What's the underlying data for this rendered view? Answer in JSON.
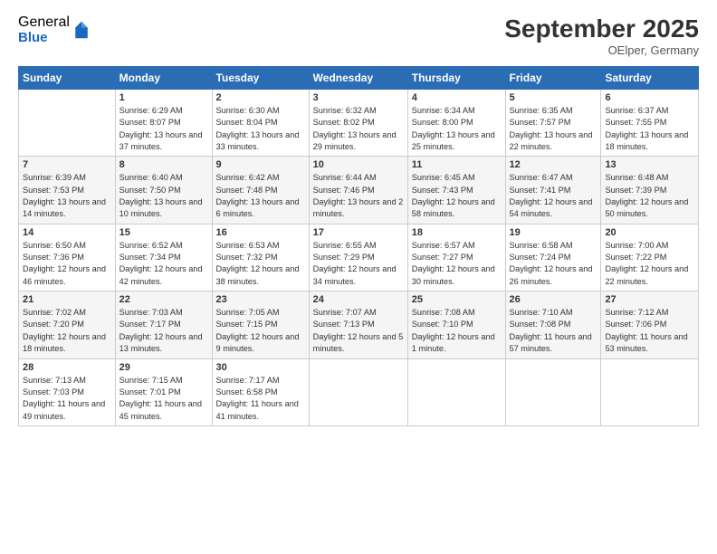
{
  "logo": {
    "general": "General",
    "blue": "Blue"
  },
  "title": "September 2025",
  "location": "OElper, Germany",
  "headers": [
    "Sunday",
    "Monday",
    "Tuesday",
    "Wednesday",
    "Thursday",
    "Friday",
    "Saturday"
  ],
  "weeks": [
    [
      {
        "num": "",
        "sunrise": "",
        "sunset": "",
        "daylight": ""
      },
      {
        "num": "1",
        "sunrise": "Sunrise: 6:29 AM",
        "sunset": "Sunset: 8:07 PM",
        "daylight": "Daylight: 13 hours and 37 minutes."
      },
      {
        "num": "2",
        "sunrise": "Sunrise: 6:30 AM",
        "sunset": "Sunset: 8:04 PM",
        "daylight": "Daylight: 13 hours and 33 minutes."
      },
      {
        "num": "3",
        "sunrise": "Sunrise: 6:32 AM",
        "sunset": "Sunset: 8:02 PM",
        "daylight": "Daylight: 13 hours and 29 minutes."
      },
      {
        "num": "4",
        "sunrise": "Sunrise: 6:34 AM",
        "sunset": "Sunset: 8:00 PM",
        "daylight": "Daylight: 13 hours and 25 minutes."
      },
      {
        "num": "5",
        "sunrise": "Sunrise: 6:35 AM",
        "sunset": "Sunset: 7:57 PM",
        "daylight": "Daylight: 13 hours and 22 minutes."
      },
      {
        "num": "6",
        "sunrise": "Sunrise: 6:37 AM",
        "sunset": "Sunset: 7:55 PM",
        "daylight": "Daylight: 13 hours and 18 minutes."
      }
    ],
    [
      {
        "num": "7",
        "sunrise": "Sunrise: 6:39 AM",
        "sunset": "Sunset: 7:53 PM",
        "daylight": "Daylight: 13 hours and 14 minutes."
      },
      {
        "num": "8",
        "sunrise": "Sunrise: 6:40 AM",
        "sunset": "Sunset: 7:50 PM",
        "daylight": "Daylight: 13 hours and 10 minutes."
      },
      {
        "num": "9",
        "sunrise": "Sunrise: 6:42 AM",
        "sunset": "Sunset: 7:48 PM",
        "daylight": "Daylight: 13 hours and 6 minutes."
      },
      {
        "num": "10",
        "sunrise": "Sunrise: 6:44 AM",
        "sunset": "Sunset: 7:46 PM",
        "daylight": "Daylight: 13 hours and 2 minutes."
      },
      {
        "num": "11",
        "sunrise": "Sunrise: 6:45 AM",
        "sunset": "Sunset: 7:43 PM",
        "daylight": "Daylight: 12 hours and 58 minutes."
      },
      {
        "num": "12",
        "sunrise": "Sunrise: 6:47 AM",
        "sunset": "Sunset: 7:41 PM",
        "daylight": "Daylight: 12 hours and 54 minutes."
      },
      {
        "num": "13",
        "sunrise": "Sunrise: 6:48 AM",
        "sunset": "Sunset: 7:39 PM",
        "daylight": "Daylight: 12 hours and 50 minutes."
      }
    ],
    [
      {
        "num": "14",
        "sunrise": "Sunrise: 6:50 AM",
        "sunset": "Sunset: 7:36 PM",
        "daylight": "Daylight: 12 hours and 46 minutes."
      },
      {
        "num": "15",
        "sunrise": "Sunrise: 6:52 AM",
        "sunset": "Sunset: 7:34 PM",
        "daylight": "Daylight: 12 hours and 42 minutes."
      },
      {
        "num": "16",
        "sunrise": "Sunrise: 6:53 AM",
        "sunset": "Sunset: 7:32 PM",
        "daylight": "Daylight: 12 hours and 38 minutes."
      },
      {
        "num": "17",
        "sunrise": "Sunrise: 6:55 AM",
        "sunset": "Sunset: 7:29 PM",
        "daylight": "Daylight: 12 hours and 34 minutes."
      },
      {
        "num": "18",
        "sunrise": "Sunrise: 6:57 AM",
        "sunset": "Sunset: 7:27 PM",
        "daylight": "Daylight: 12 hours and 30 minutes."
      },
      {
        "num": "19",
        "sunrise": "Sunrise: 6:58 AM",
        "sunset": "Sunset: 7:24 PM",
        "daylight": "Daylight: 12 hours and 26 minutes."
      },
      {
        "num": "20",
        "sunrise": "Sunrise: 7:00 AM",
        "sunset": "Sunset: 7:22 PM",
        "daylight": "Daylight: 12 hours and 22 minutes."
      }
    ],
    [
      {
        "num": "21",
        "sunrise": "Sunrise: 7:02 AM",
        "sunset": "Sunset: 7:20 PM",
        "daylight": "Daylight: 12 hours and 18 minutes."
      },
      {
        "num": "22",
        "sunrise": "Sunrise: 7:03 AM",
        "sunset": "Sunset: 7:17 PM",
        "daylight": "Daylight: 12 hours and 13 minutes."
      },
      {
        "num": "23",
        "sunrise": "Sunrise: 7:05 AM",
        "sunset": "Sunset: 7:15 PM",
        "daylight": "Daylight: 12 hours and 9 minutes."
      },
      {
        "num": "24",
        "sunrise": "Sunrise: 7:07 AM",
        "sunset": "Sunset: 7:13 PM",
        "daylight": "Daylight: 12 hours and 5 minutes."
      },
      {
        "num": "25",
        "sunrise": "Sunrise: 7:08 AM",
        "sunset": "Sunset: 7:10 PM",
        "daylight": "Daylight: 12 hours and 1 minute."
      },
      {
        "num": "26",
        "sunrise": "Sunrise: 7:10 AM",
        "sunset": "Sunset: 7:08 PM",
        "daylight": "Daylight: 11 hours and 57 minutes."
      },
      {
        "num": "27",
        "sunrise": "Sunrise: 7:12 AM",
        "sunset": "Sunset: 7:06 PM",
        "daylight": "Daylight: 11 hours and 53 minutes."
      }
    ],
    [
      {
        "num": "28",
        "sunrise": "Sunrise: 7:13 AM",
        "sunset": "Sunset: 7:03 PM",
        "daylight": "Daylight: 11 hours and 49 minutes."
      },
      {
        "num": "29",
        "sunrise": "Sunrise: 7:15 AM",
        "sunset": "Sunset: 7:01 PM",
        "daylight": "Daylight: 11 hours and 45 minutes."
      },
      {
        "num": "30",
        "sunrise": "Sunrise: 7:17 AM",
        "sunset": "Sunset: 6:58 PM",
        "daylight": "Daylight: 11 hours and 41 minutes."
      },
      {
        "num": "",
        "sunrise": "",
        "sunset": "",
        "daylight": ""
      },
      {
        "num": "",
        "sunrise": "",
        "sunset": "",
        "daylight": ""
      },
      {
        "num": "",
        "sunrise": "",
        "sunset": "",
        "daylight": ""
      },
      {
        "num": "",
        "sunrise": "",
        "sunset": "",
        "daylight": ""
      }
    ]
  ]
}
